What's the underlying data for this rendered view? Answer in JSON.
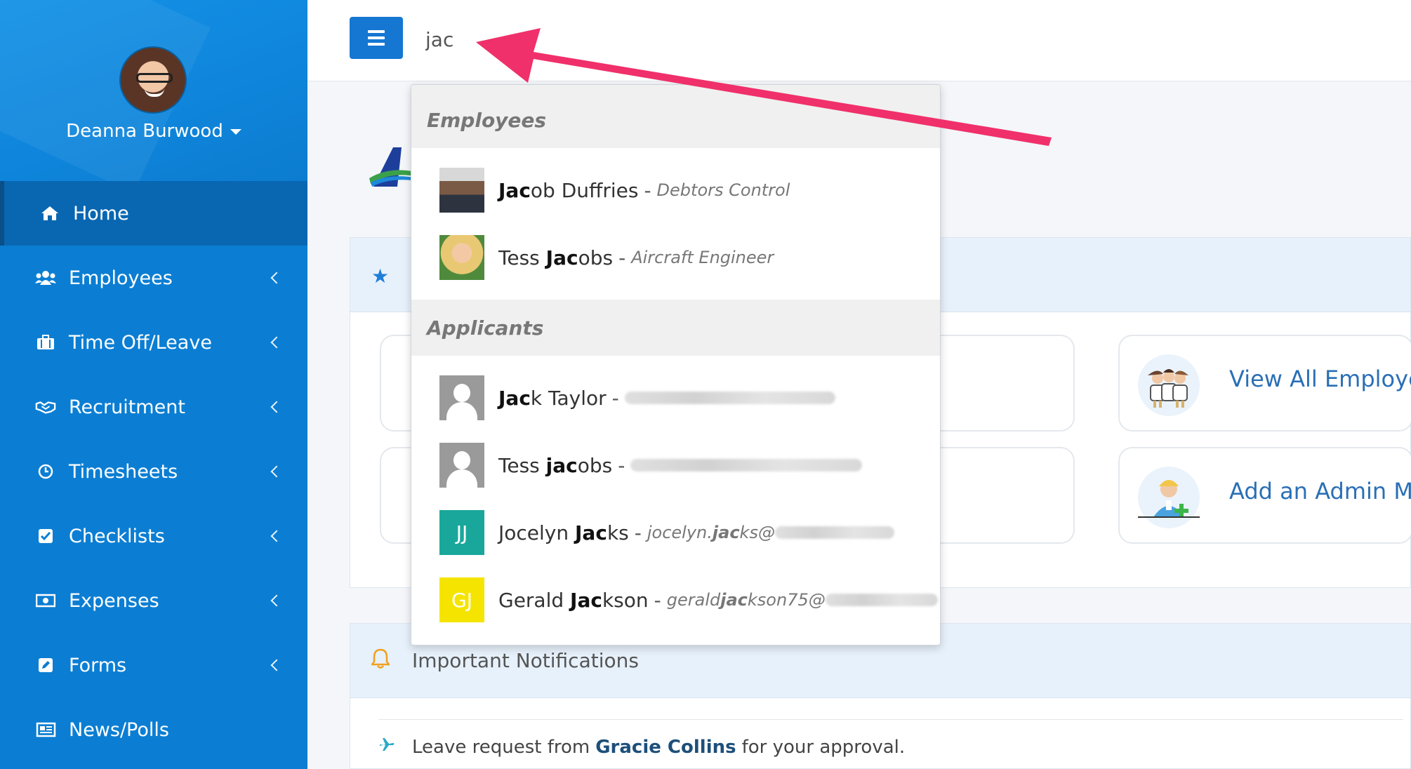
{
  "profile": {
    "name": "Deanna Burwood"
  },
  "nav": {
    "items": [
      {
        "label": "Home",
        "icon": "home-icon"
      },
      {
        "label": "Employees",
        "icon": "users-icon"
      },
      {
        "label": "Time Off/Leave",
        "icon": "briefcase-icon"
      },
      {
        "label": "Recruitment",
        "icon": "handshake-icon"
      },
      {
        "label": "Timesheets",
        "icon": "clock-icon"
      },
      {
        "label": "Checklists",
        "icon": "checkbox-icon"
      },
      {
        "label": "Expenses",
        "icon": "money-icon"
      },
      {
        "label": "Forms",
        "icon": "edit-icon"
      },
      {
        "label": "News/Polls",
        "icon": "newspaper-icon"
      }
    ]
  },
  "search": {
    "value": "jac"
  },
  "dropdown": {
    "employees_header": "Employees",
    "employees": [
      {
        "match": "Jac",
        "rest": "ob Duffries",
        "title": "Debtors Control"
      },
      {
        "pre": "Tess ",
        "match": "Jac",
        "rest": "obs",
        "title": "Aircraft Engineer"
      }
    ],
    "applicants_header": "Applicants",
    "applicants": [
      {
        "match": "Jac",
        "rest": "k Taylor",
        "initials": ""
      },
      {
        "pre": "Tess ",
        "match": "jac",
        "rest": "obs",
        "initials": ""
      },
      {
        "pre": "Jocelyn ",
        "match": "Jac",
        "rest": "ks",
        "initials": "JJ",
        "email_pre": "jocelyn.",
        "email_match": "jac",
        "email_rest": "ks@"
      },
      {
        "pre": "Gerald ",
        "match": "Jac",
        "rest": "kson",
        "initials": "GJ",
        "email_pre": "gerald",
        "email_match": "jac",
        "email_rest": "kson75@"
      }
    ]
  },
  "cards": {
    "view_all": "View All Employe",
    "add_admin": "Add an Admin Ma"
  },
  "notifications": {
    "title": "Important Notifications",
    "item_pre": "Leave request from",
    "item_name": "Gracie Collins",
    "item_post": "for your approval."
  },
  "colors": {
    "sidebar": "#0b7ed3",
    "accent": "#1677d2",
    "arrow": "#f0306a"
  }
}
